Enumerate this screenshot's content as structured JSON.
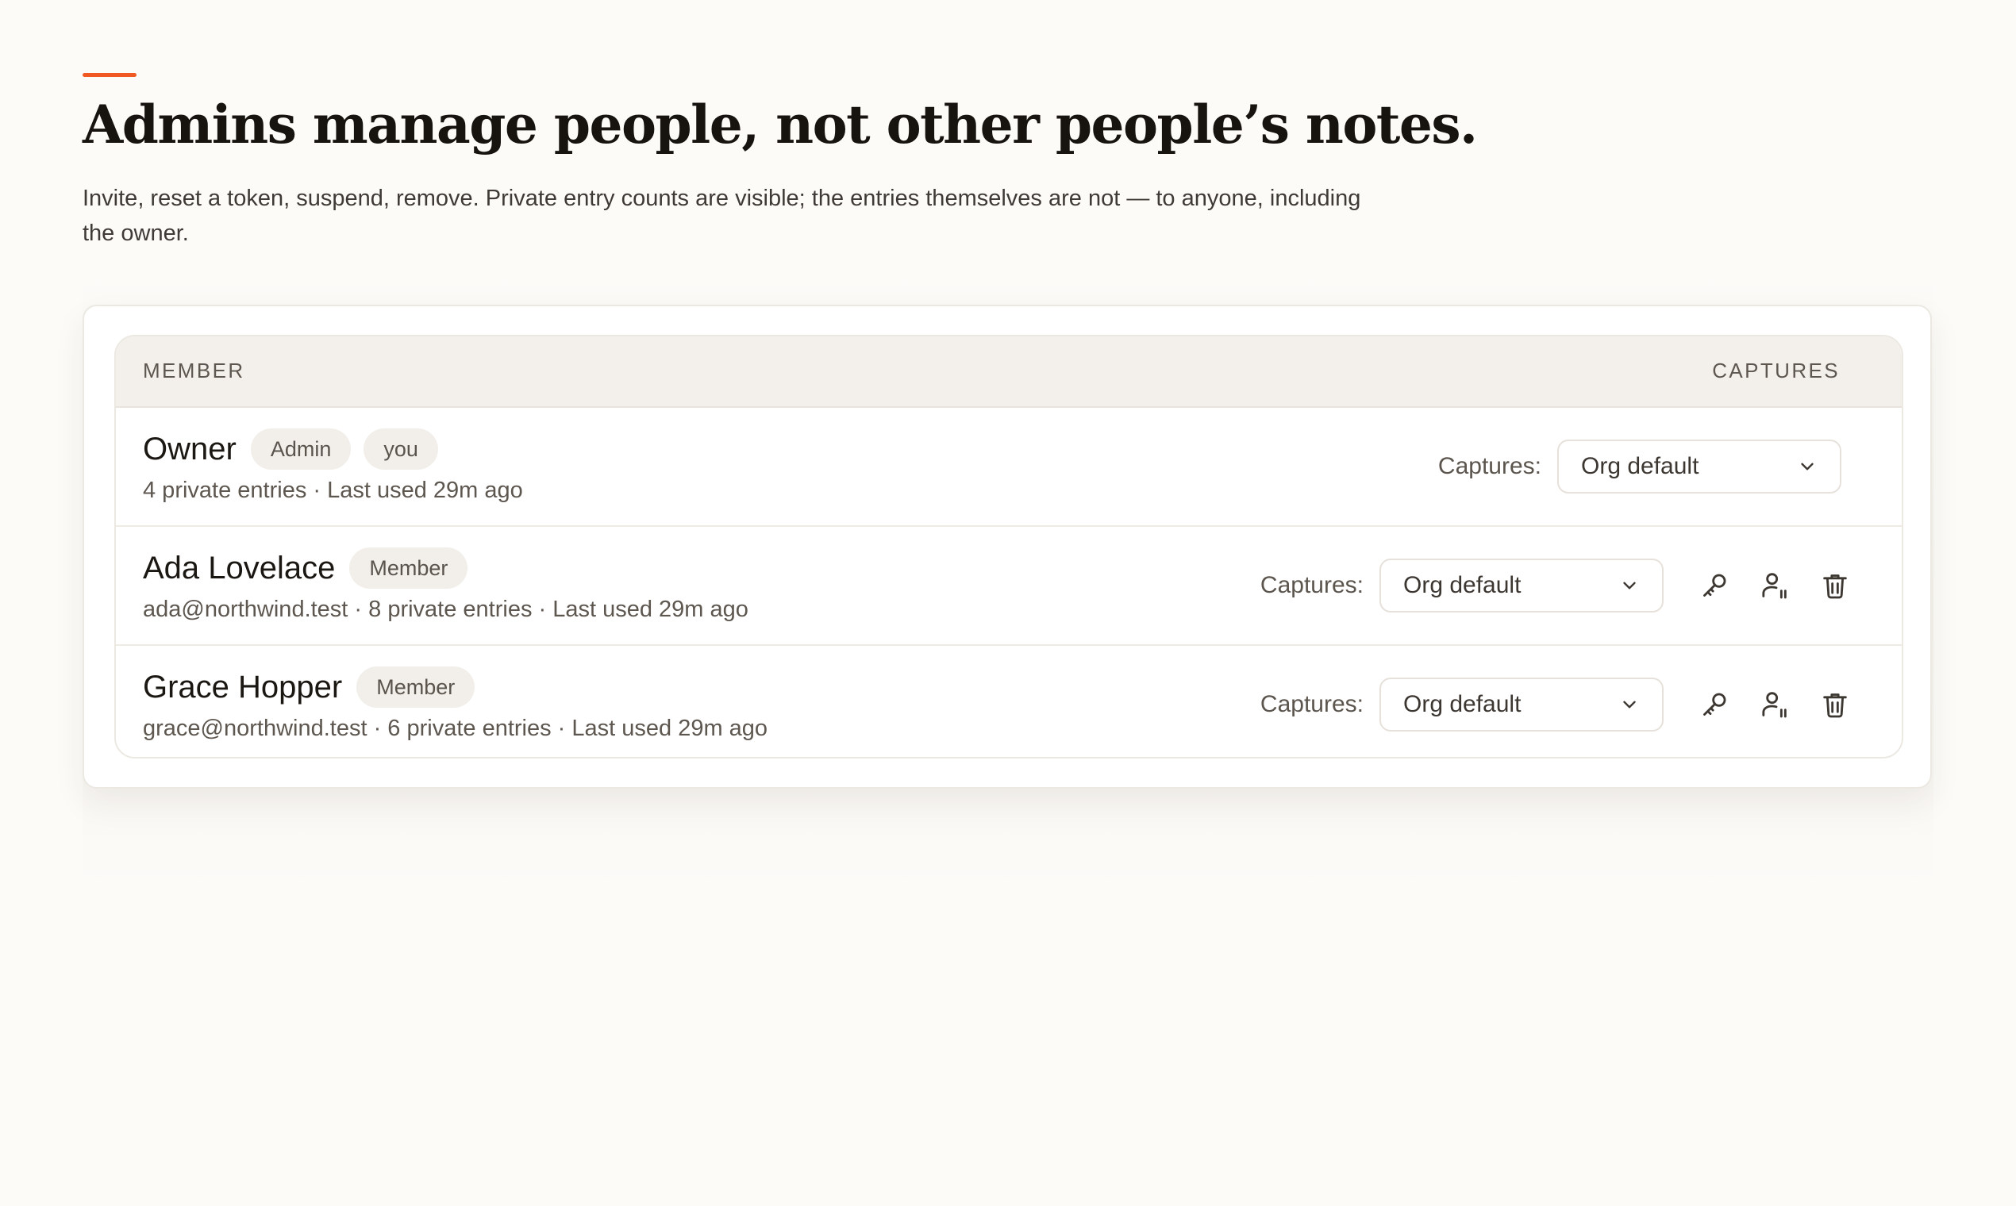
{
  "header": {
    "title": "Admins manage people, not other people’s notes.",
    "subtitle": "Invite, reset a token, suspend, remove. Private entry counts are visible; the entries themselves are not — to anyone, including the owner."
  },
  "table": {
    "columns": {
      "member": "MEMBER",
      "captures": "CAPTURES"
    },
    "captures_label": "Captures:",
    "rows": [
      {
        "name": "Owner",
        "badges": [
          "Admin",
          "you"
        ],
        "meta": "4 private entries · Last used 29m ago",
        "captures_value": "Org default"
      },
      {
        "name": "Ada Lovelace",
        "badges": [
          "Member"
        ],
        "meta": "ada@northwind.test · 8 private entries · Last used 29m ago",
        "captures_value": "Org default",
        "actions": [
          "key-icon",
          "suspend-user-icon",
          "trash-icon"
        ]
      },
      {
        "name": "Grace Hopper",
        "badges": [
          "Member"
        ],
        "meta": "grace@northwind.test · 6 private entries · Last used 29m ago",
        "captures_value": "Org default",
        "actions": [
          "key-icon",
          "suspend-user-icon",
          "trash-icon"
        ]
      }
    ]
  },
  "colors": {
    "accent": "#f05a22",
    "background": "#fcfbf8",
    "header_row": "#f3f0ec",
    "badge": "#f2efea"
  }
}
